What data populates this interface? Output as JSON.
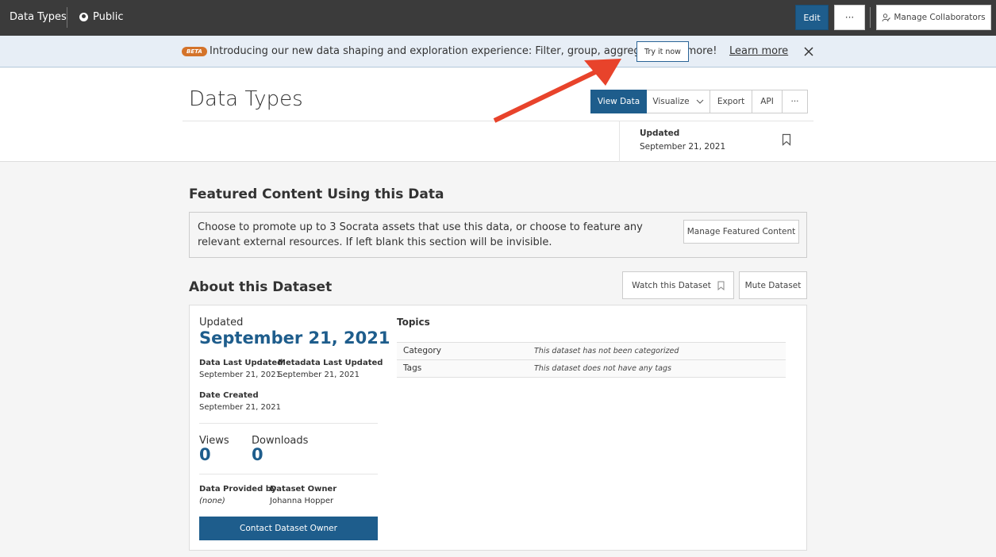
{
  "topbar": {
    "title": "Data Types",
    "visibility": "Public",
    "edit_label": "Edit",
    "more_label": "···",
    "collab_label": "Manage Collaborators"
  },
  "banner": {
    "badge": "BETA",
    "text": "Introducing our new data shaping and exploration experience: Filter, group, aggregate, and more!",
    "try_label": "Try it now",
    "learn_label": "Learn more"
  },
  "header": {
    "title": "Data Types",
    "actions": {
      "view": "View Data",
      "visualize": "Visualize",
      "export": "Export",
      "api": "API",
      "more": "···"
    },
    "updated_label": "Updated",
    "updated_date": "September 21, 2021"
  },
  "featured": {
    "title": "Featured Content Using this Data",
    "text": "Choose to promote up to 3 Socrata assets that use this data, or choose to feature any relevant external resources. If left blank this section will be invisible.",
    "manage_label": "Manage Featured Content"
  },
  "about": {
    "title": "About this Dataset",
    "watch_label": "Watch this Dataset",
    "mute_label": "Mute Dataset",
    "updated_label": "Updated",
    "updated_date": "September 21, 2021",
    "data_last_updated_label": "Data Last Updated",
    "data_last_updated": "September 21, 2021",
    "metadata_last_updated_label": "Metadata Last Updated",
    "metadata_last_updated": "September 21, 2021",
    "date_created_label": "Date Created",
    "date_created": "September 21, 2021",
    "views_label": "Views",
    "views": "0",
    "downloads_label": "Downloads",
    "downloads": "0",
    "provided_by_label": "Data Provided by",
    "provided_by": "(none)",
    "owner_label": "Dataset Owner",
    "owner": "Johanna Hopper",
    "contact_label": "Contact Dataset Owner",
    "topics_title": "Topics",
    "topics": [
      {
        "key": "Category",
        "value": "This dataset has not been categorized"
      },
      {
        "key": "Tags",
        "value": "This dataset does not have any tags"
      }
    ]
  },
  "colors": {
    "accent": "#1e5d8c",
    "topbar": "#3b3b3b",
    "beta": "#d4732a",
    "arrow": "#e8432b"
  }
}
